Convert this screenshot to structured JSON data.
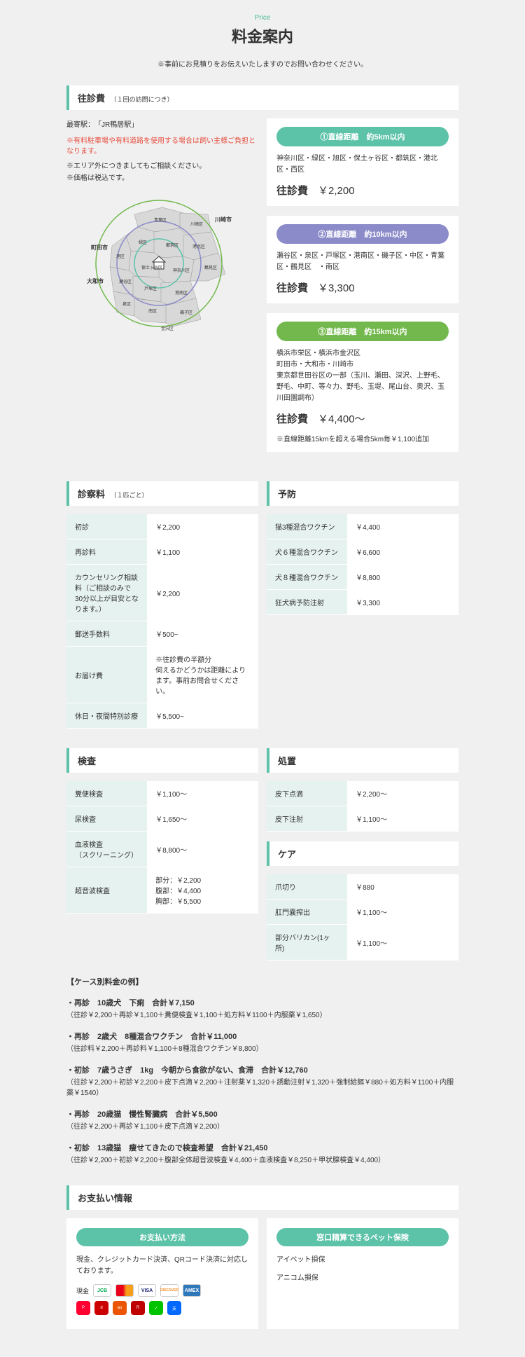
{
  "page": {
    "subtitle": "Price",
    "title": "料金案内",
    "note": "※事前にお見積りをお伝えいたしますのでお問い合わせください。"
  },
  "visit": {
    "header": "往診費",
    "headerSub": "（１回の訪問につき）",
    "station": "最寄駅：　「JR鴨居駅」",
    "noticeRed": "※有料駐車場や有料道路を使用する場合は飼い主様ご負担となります。",
    "notice1": "※エリア外につきましてもご相談ください。",
    "notice2": "※価格は税込です。"
  },
  "map": {
    "labels": {
      "kawasaki": "川崎市",
      "machida": "町田市",
      "yamato": "大和市"
    },
    "wards": [
      "青葉区",
      "都筑区",
      "港北区",
      "緑区",
      "神奈川区",
      "旭区",
      "保土ヶ谷区",
      "瀬谷区",
      "戸塚区",
      "泉区",
      "港南区",
      "南区",
      "西区",
      "中区",
      "磯子区",
      "金沢区",
      "栄区",
      "鶴見区"
    ]
  },
  "zones": [
    {
      "badge": "①直線距離　約5km以内",
      "cls": "teal",
      "areas": "神奈川区・緑区・旭区・保土ヶ谷区・都筑区・港北区・西区",
      "label": "往診費",
      "price": "￥2,200"
    },
    {
      "badge": "②直線距離　約10km以内",
      "cls": "purple",
      "areas": "瀬谷区・泉区・戸塚区・港南区・磯子区・中区・青葉区・鶴見区　・南区",
      "label": "往診費",
      "price": "￥3,300"
    },
    {
      "badge": "③直線距離　約15km以内",
      "cls": "green",
      "areas": "横浜市栄区・横浜市金沢区\n町田市・大和市・川崎市\n東京都世田谷区の一部（玉川、瀬田、深沢、上野毛、野毛、中町、等々力、野毛、玉堤、尾山台、奥沢、玉川田園調布）",
      "label": "往診費",
      "price": "￥4,400〜",
      "note": "※直線距離15kmを超える場合5km毎￥1,100追加"
    }
  ],
  "fees": {
    "header": "診察料",
    "headerSub": "（１匹ごと）",
    "rows": [
      {
        "name": "初診",
        "price": "￥2,200"
      },
      {
        "name": "再診料",
        "price": "￥1,100"
      },
      {
        "name": "カウンセリング相談料（ご相談のみで30分以上が目安となります。）",
        "price": "￥2,200"
      },
      {
        "name": "郵送手数料",
        "price": "￥500~"
      },
      {
        "name": "お届け費",
        "price": "※往診費の半額分\n伺えるかどうかは距離によります。事前お問合せください。"
      },
      {
        "name": "休日・夜間特別診療",
        "price": "￥5,500~"
      }
    ]
  },
  "prevention": {
    "header": "予防",
    "rows": [
      {
        "name": "猫3種混合ワクチン",
        "price": "￥4,400"
      },
      {
        "name": "犬６種混合ワクチン",
        "price": "￥6,600"
      },
      {
        "name": "犬８種混合ワクチン",
        "price": "￥8,800"
      },
      {
        "name": "狂犬病予防注射",
        "price": "￥3,300"
      }
    ]
  },
  "exam": {
    "header": "検査",
    "rows": [
      {
        "name": "糞便検査",
        "price": "￥1,100～"
      },
      {
        "name": "尿検査",
        "price": "￥1,650～"
      },
      {
        "name": "血液検査\n（スクリーニング）",
        "price": "￥8,800～"
      },
      {
        "name": "超音波検査",
        "price": "部分：￥2,200\n腹部：￥4,400\n胸部：￥5,500"
      }
    ]
  },
  "treat": {
    "header": "処置",
    "rows": [
      {
        "name": "皮下点滴",
        "price": "￥2,200～"
      },
      {
        "name": "皮下注射",
        "price": "￥1,100～"
      }
    ]
  },
  "care": {
    "header": "ケア",
    "rows": [
      {
        "name": "爪切り",
        "price": "￥880"
      },
      {
        "name": "肛門嚢搾出",
        "price": "￥1,100～"
      },
      {
        "name": "部分バリカン(1ヶ所)",
        "price": "￥1,100～"
      }
    ]
  },
  "cases": {
    "title": "【ケース別料金の例】",
    "items": [
      {
        "head": "・再診　10歳犬　下痢　合計￥7,150",
        "detail": "（往診￥2,200＋再診￥1,100＋糞便検査￥1,100＋処方料￥1100＋内服薬￥1,650）"
      },
      {
        "head": "・再診　2歳犬　8種混合ワクチン　合計￥11,000",
        "detail": "（往診料￥2,200＋再診料￥1,100＋8種混合ワクチン￥8,800）"
      },
      {
        "head": "・初診　7歳うさぎ　1kg　今朝から食欲がない、食滞　合計￥12,760",
        "detail": "（往診￥2,200＋初診￥2,200＋皮下点滴￥2,200＋注射薬￥1,320＋誘動注射￥1,320＋強制給餌￥880＋処方料￥1100＋内服薬￥1540）"
      },
      {
        "head": "・再診　20歳猫　慢性腎臓病　合計￥5,500",
        "detail": "（往診￥2,200＋再診￥1,100＋皮下点滴￥2,200）"
      },
      {
        "head": "・初診　13歳猫　痩せてきたので検査希望　合計￥21,450",
        "detail": "（往診￥2,200＋初診￥2,200＋腹部全体超音波検査￥4,400＋血液検査￥8,250＋甲状腺検査￥4,400）"
      }
    ]
  },
  "payment": {
    "header": "お支払い情報",
    "methodTitle": "お支払い方法",
    "methodText": "現金、クレジットカード決済、QRコード決済に対応しております。",
    "cashLabel": "現金",
    "insuranceTitle": "窓口精算できるペット保険",
    "insurances": [
      "アイペット損保",
      "アニコム損保"
    ]
  }
}
